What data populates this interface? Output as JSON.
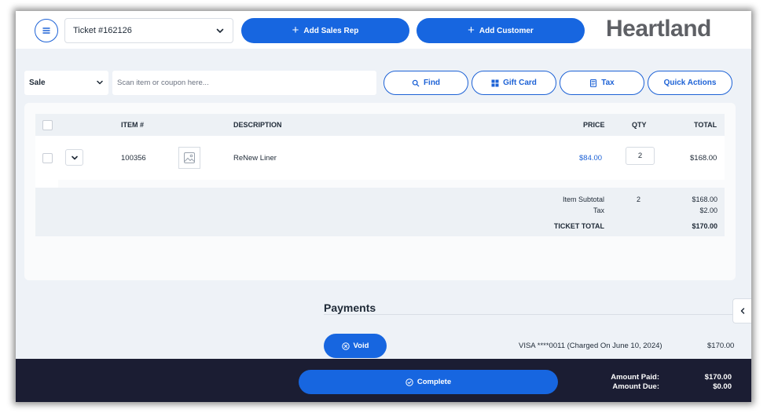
{
  "header": {
    "ticket_label": "Ticket #162126",
    "add_sales_rep": "Add Sales Rep",
    "add_customer": "Add Customer",
    "logo": "Heartland"
  },
  "toolbar": {
    "sale_type": "Sale",
    "scan_placeholder": "Scan item or coupon here...",
    "find": "Find",
    "gift_card": "Gift Card",
    "tax": "Tax",
    "quick_actions": "Quick Actions"
  },
  "table": {
    "headers": {
      "item": "ITEM #",
      "description": "DESCRIPTION",
      "price": "PRICE",
      "qty": "QTY",
      "total": "TOTAL"
    },
    "rows": [
      {
        "item": "100356",
        "description": "ReNew Liner",
        "price": "$84.00",
        "qty": "2",
        "total": "$168.00"
      }
    ]
  },
  "totals": {
    "subtotal_label": "Item Subtotal",
    "subtotal_qty": "2",
    "subtotal_value": "$168.00",
    "tax_label": "Tax",
    "tax_value": "$2.00",
    "ticket_total_label": "TICKET TOTAL",
    "ticket_total_value": "$170.00"
  },
  "payments": {
    "title": "Payments",
    "void_label": "Void",
    "entries": [
      {
        "description": "VISA ****0011 (Charged On June 10, 2024)",
        "amount": "$170.00"
      }
    ]
  },
  "footer": {
    "complete_label": "Complete",
    "amount_paid_label": "Amount Paid:",
    "amount_paid_value": "$170.00",
    "amount_due_label": "Amount Due:",
    "amount_due_value": "$0.00"
  },
  "colors": {
    "primary": "#1766e0",
    "footer_bg": "#1b1d33",
    "page_bg": "#eef2f7"
  }
}
